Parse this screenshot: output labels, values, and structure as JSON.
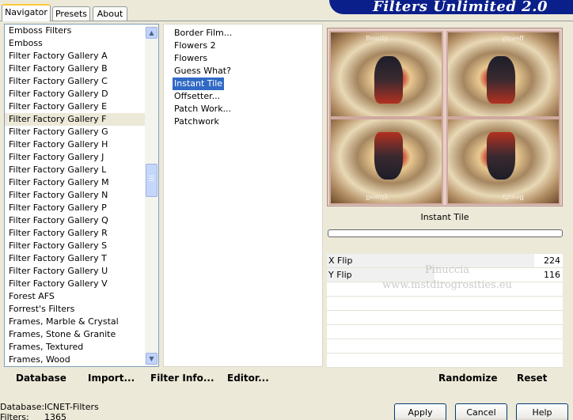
{
  "banner": {
    "title": "Filters Unlimited 2.0"
  },
  "tabs": [
    {
      "label": "Navigator"
    },
    {
      "label": "Presets"
    },
    {
      "label": "About"
    }
  ],
  "categories": {
    "selected": "Filter Factory Gallery F",
    "items": [
      "Emboss Filters",
      "Emboss",
      "Filter Factory Gallery A",
      "Filter Factory Gallery B",
      "Filter Factory Gallery C",
      "Filter Factory Gallery D",
      "Filter Factory Gallery E",
      "Filter Factory Gallery F",
      "Filter Factory Gallery G",
      "Filter Factory Gallery H",
      "Filter Factory Gallery J",
      "Filter Factory Gallery L",
      "Filter Factory Gallery M",
      "Filter Factory Gallery N",
      "Filter Factory Gallery P",
      "Filter Factory Gallery Q",
      "Filter Factory Gallery R",
      "Filter Factory Gallery S",
      "Filter Factory Gallery T",
      "Filter Factory Gallery U",
      "Filter Factory Gallery V",
      "Forest AFS",
      "Forrest's Filters",
      "Frames, Marble & Crystal",
      "Frames, Stone & Granite",
      "Frames, Textured",
      "Frames, Wood"
    ]
  },
  "filters": {
    "selected": "Instant Tile",
    "items": [
      "Border Film...",
      "Flowers 2",
      "Flowers",
      "Guess What?",
      "Instant Tile",
      "Offsetter...",
      "Patch Work...",
      "Patchwork"
    ]
  },
  "preview": {
    "tile_caption": "Beauty",
    "filter_name": "Instant Tile",
    "progress": 0
  },
  "params": [
    {
      "name": "X Flip",
      "value": "224",
      "level": 0.878
    },
    {
      "name": "Y Flip",
      "value": "116",
      "level": 0.455
    },
    {
      "name": "",
      "value": ""
    },
    {
      "name": "",
      "value": ""
    },
    {
      "name": "",
      "value": ""
    },
    {
      "name": "",
      "value": ""
    },
    {
      "name": "",
      "value": ""
    },
    {
      "name": "",
      "value": ""
    }
  ],
  "watermark": {
    "line1": "Pinuccia",
    "line2": "www.mstdirogrosities.eu"
  },
  "left_actions": {
    "database": "Database",
    "import": "Import...",
    "filter_info": "Filter Info...",
    "editor": "Editor..."
  },
  "right_actions": {
    "randomize": "Randomize",
    "reset": "Reset"
  },
  "status": {
    "database_label": "Database:",
    "database_value": "ICNET-Filters",
    "filters_label": "Filters:",
    "filters_value": "1365"
  },
  "buttons": {
    "apply": "Apply",
    "cancel": "Cancel",
    "help": "Help"
  },
  "colors": {
    "selection": "#316ac5",
    "banner": "#0a1f8a",
    "face": "#ece9d8"
  }
}
